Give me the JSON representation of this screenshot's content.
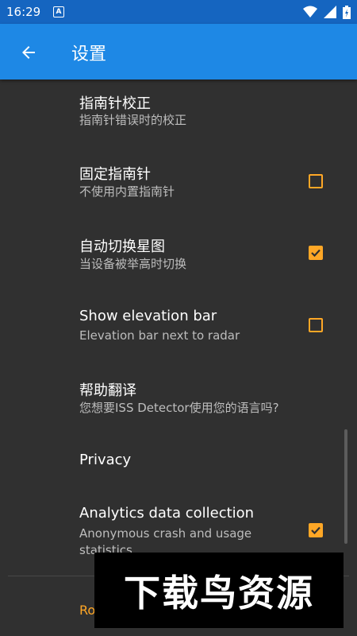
{
  "status_bar": {
    "time": "16:29",
    "notif": "A"
  },
  "app_bar": {
    "title": "设置"
  },
  "settings": [
    {
      "title": "指南针校正",
      "subtitle": "指南针错误时的校正"
    },
    {
      "title": "固定指南针",
      "subtitle": "不使用内置指南针",
      "checked": false
    },
    {
      "title": "自动切换星图",
      "subtitle": "当设备被举高时切换",
      "checked": true
    },
    {
      "title": "Show elevation bar",
      "subtitle": "Elevation bar next to radar",
      "checked": false
    },
    {
      "title": "帮助翻译",
      "subtitle": "您想要ISS Detector使用您的语言吗?"
    },
    {
      "title": "Privacy"
    },
    {
      "title": "Analytics data collection",
      "subtitle": "Anonymous crash and usage statistics",
      "checked": true
    }
  ],
  "footer": {
    "label": "Ro"
  },
  "watermark": {
    "text": "下载鸟资源"
  },
  "colors": {
    "accent": "#ffa726",
    "appbar": "#1e88e5",
    "statusbar": "#1565c0",
    "background": "#303030"
  }
}
